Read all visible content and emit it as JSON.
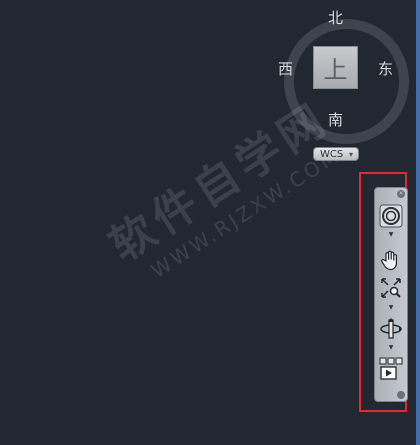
{
  "viewcube": {
    "north": "北",
    "south": "南",
    "west": "西",
    "east": "东",
    "face": "上"
  },
  "ucs_menu": {
    "label": "WCS"
  },
  "watermark": {
    "text": "软件自学网",
    "url": "WWW.RJZXW.COM"
  },
  "navbar": {
    "tools": [
      {
        "name": "steering-wheel",
        "icon": "steering-wheel-icon"
      },
      {
        "name": "pan",
        "icon": "hand-icon"
      },
      {
        "name": "zoom",
        "icon": "zoom-extents-icon"
      },
      {
        "name": "orbit",
        "icon": "orbit-icon"
      },
      {
        "name": "showmotion",
        "icon": "showmotion-icon"
      }
    ],
    "highlight_color": "#e8262b"
  }
}
